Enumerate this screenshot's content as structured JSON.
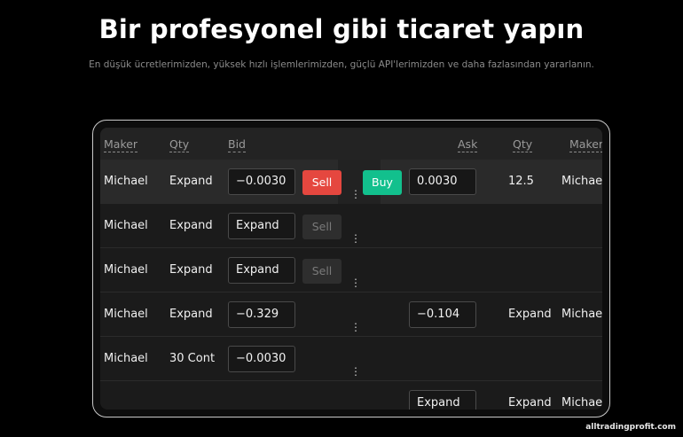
{
  "hero": {
    "title": "Bir profesyonel gibi ticaret yapın",
    "subtitle": "En düşük ücretlerimizden, yüksek hızlı işlemlerimizden, güçlü API'lerimizden ve daha fazlasından yararlanın."
  },
  "table": {
    "headers": {
      "maker_left": "Maker",
      "qty_left": "Qty",
      "bid": "Bid",
      "ask": "Ask",
      "qty_right": "Qty",
      "maker_right": "Maker"
    },
    "rows": [
      {
        "maker": "Michael",
        "qty": "Expand",
        "bid": "−0.0030",
        "sell": "Sell",
        "buy": "Buy",
        "ask": "0.0030",
        "qty_r": "12.5",
        "maker_r": "Michael"
      },
      {
        "maker": "Michael",
        "qty": "Expand",
        "bid": "Expand",
        "sell": "Sell"
      },
      {
        "maker": "Michael",
        "qty": "Expand",
        "bid": "Expand",
        "sell": "Sell"
      },
      {
        "maker": "Michael",
        "qty": "Expand",
        "bid": "−0.329",
        "ask": "−0.104",
        "qty_r": "Expand",
        "maker_r": "Michael"
      },
      {
        "maker": "Michael",
        "qty": "30 Cont",
        "bid": "−0.0030"
      },
      {
        "ask": "Expand",
        "qty_r": "Expand",
        "maker_r": "Michael"
      }
    ],
    "dots": "⋮"
  },
  "watermark": "alltradingprofit.com",
  "colors": {
    "sell": "#e5473f",
    "buy": "#12c08d",
    "background": "#000000"
  }
}
